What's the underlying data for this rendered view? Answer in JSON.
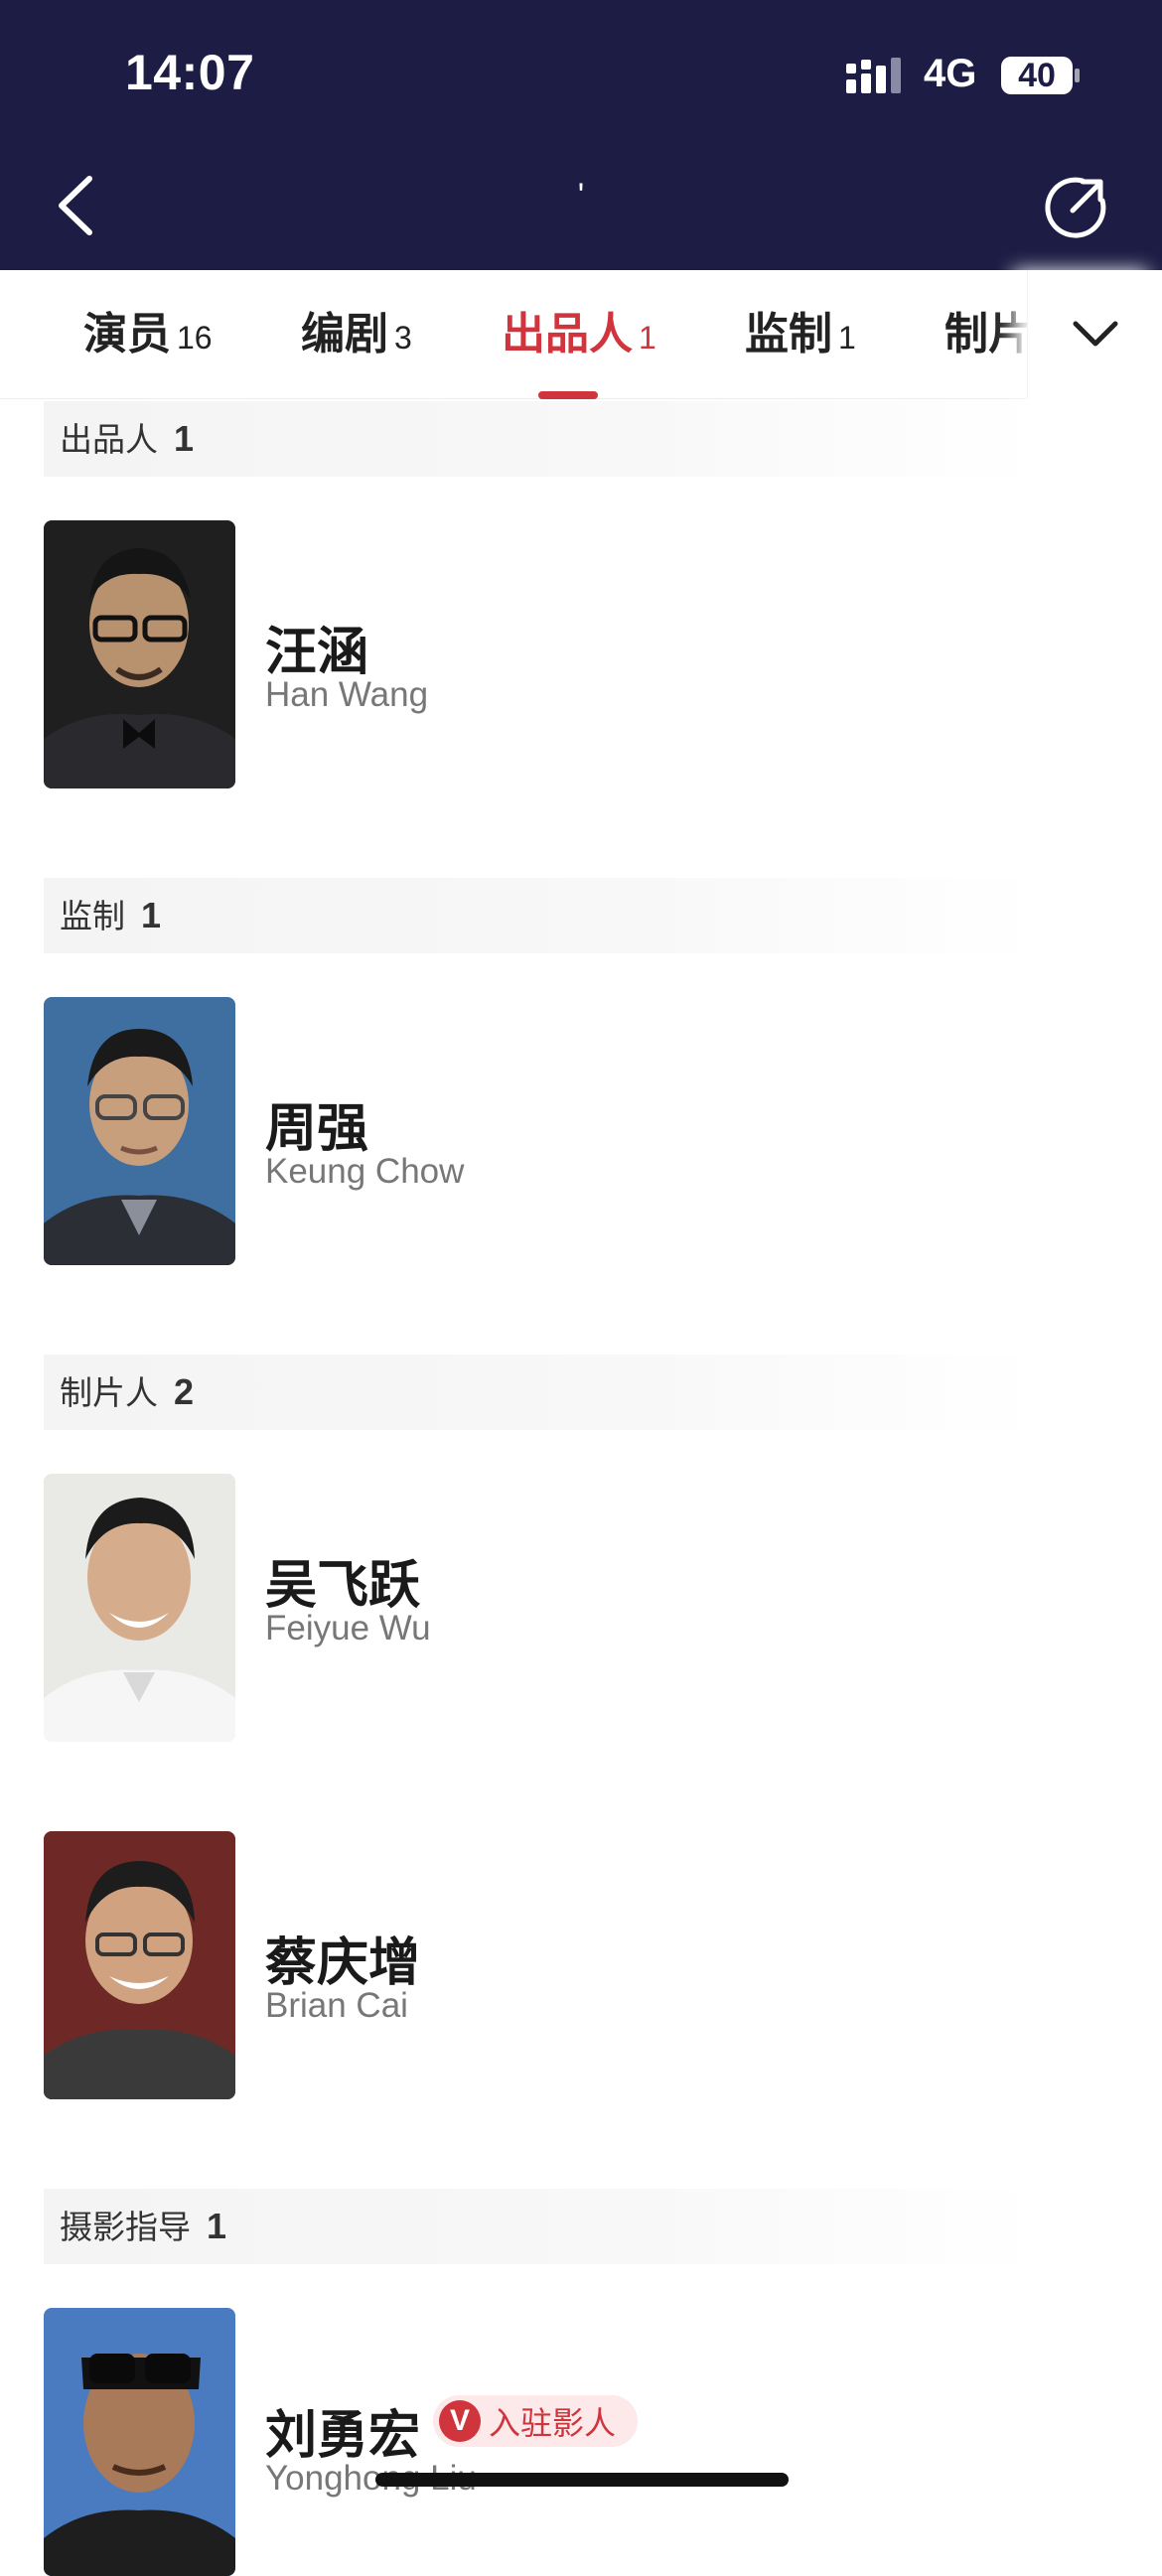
{
  "status_bar": {
    "time": "14:07",
    "network": "4G",
    "battery": "40"
  },
  "nav": {
    "title": "'",
    "back_icon": "chevron-left-icon",
    "share_icon": "share-icon"
  },
  "tabs": [
    {
      "label": "演员",
      "count": "16"
    },
    {
      "label": "编剧",
      "count": "3"
    },
    {
      "label": "出品人",
      "count": "1",
      "active": true
    },
    {
      "label": "监制",
      "count": "1"
    },
    {
      "label": "制片",
      "count": ""
    }
  ],
  "accent_color": "#d0343d",
  "header_color": "#1c1c44",
  "sections": [
    {
      "title": "出品人",
      "count": "1",
      "people": [
        {
          "name_cn": "汪涵",
          "name_en": "Han Wang"
        }
      ]
    },
    {
      "title": "监制",
      "count": "1",
      "people": [
        {
          "name_cn": "周强",
          "name_en": "Keung Chow"
        }
      ]
    },
    {
      "title": "制片人",
      "count": "2",
      "people": [
        {
          "name_cn": "吴飞跃",
          "name_en": "Feiyue Wu"
        },
        {
          "name_cn": "蔡庆增",
          "name_en": "Brian Cai"
        }
      ]
    },
    {
      "title": "摄影指导",
      "count": "1",
      "people": [
        {
          "name_cn": "刘勇宏",
          "name_en": "Yonghong Liu",
          "badge": {
            "icon": "V",
            "text": "入驻影人"
          }
        }
      ]
    }
  ]
}
